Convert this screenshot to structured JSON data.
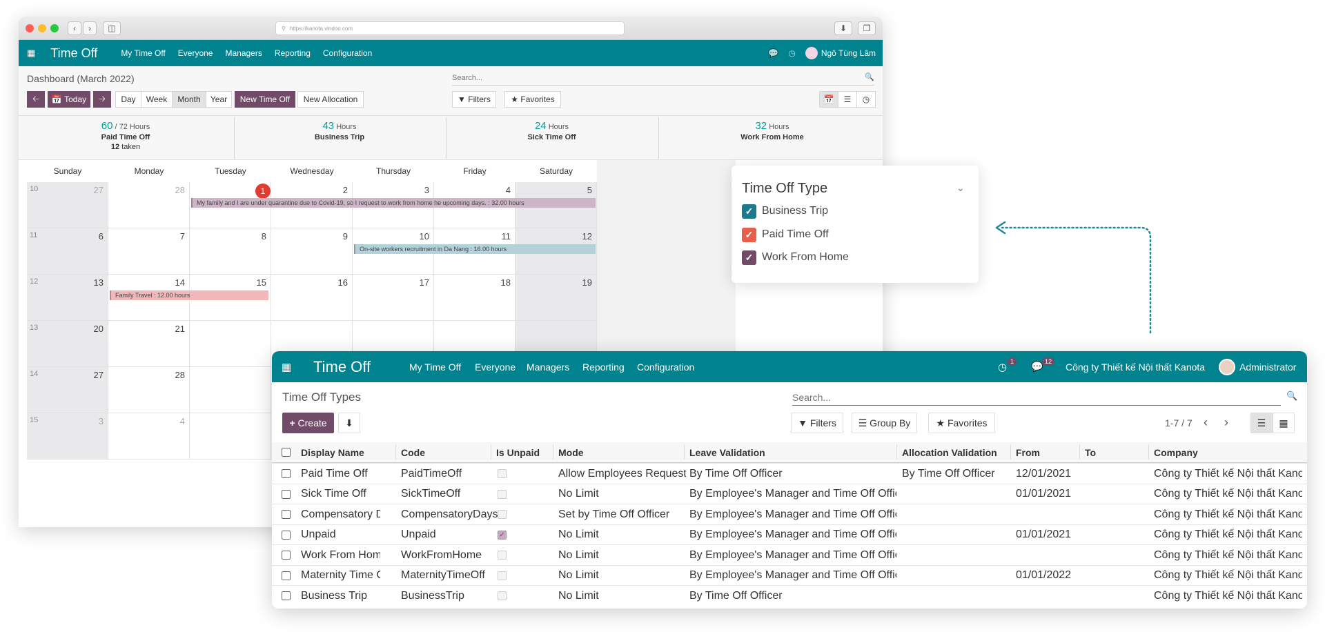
{
  "back_window": {
    "url": "https://kanota.vindoo.com",
    "nav": {
      "brand": "Time Off",
      "menus": [
        "My Time Off",
        "Everyone",
        "Managers",
        "Reporting",
        "Configuration"
      ],
      "user": "Ngô Tùng Lâm"
    },
    "control": {
      "breadcrumb": "Dashboard (March 2022)",
      "today_label": "Today",
      "views": [
        "Day",
        "Week",
        "Month",
        "Year"
      ],
      "active_view": "Month",
      "new_time_off": "New Time Off",
      "new_allocation": "New Allocation",
      "search_placeholder": "Search...",
      "filters": "Filters",
      "favorites": "Favorites"
    },
    "stats": [
      {
        "num": "60",
        "unit": " / 72 Hours",
        "label": "Paid Time Off",
        "extra_num": "12",
        "extra": " taken"
      },
      {
        "num": "43",
        "unit": " Hours",
        "label": "Business Trip"
      },
      {
        "num": "24",
        "unit": " Hours",
        "label": "Sick Time Off"
      },
      {
        "num": "32",
        "unit": " Hours",
        "label": "Work From Home"
      }
    ],
    "calendar": {
      "days": [
        "Sunday",
        "Monday",
        "Tuesday",
        "Wednesday",
        "Thursday",
        "Friday",
        "Saturday"
      ],
      "weeks": [
        {
          "wk": "10",
          "dates": [
            "27",
            "28",
            "1",
            "2",
            "3",
            "4",
            "5"
          ],
          "muted": [
            true,
            true,
            false,
            false,
            false,
            false,
            false
          ]
        },
        {
          "wk": "11",
          "dates": [
            "6",
            "7",
            "8",
            "9",
            "10",
            "11",
            "12"
          ],
          "muted": [
            false,
            false,
            false,
            false,
            false,
            false,
            false
          ]
        },
        {
          "wk": "12",
          "dates": [
            "13",
            "14",
            "15",
            "16",
            "17",
            "18",
            "19"
          ],
          "muted": [
            false,
            false,
            false,
            false,
            false,
            false,
            false
          ]
        },
        {
          "wk": "13",
          "dates": [
            "20",
            "21",
            "",
            "",
            "",
            "",
            ""
          ],
          "muted": [
            false,
            false,
            false,
            false,
            false,
            false,
            false
          ]
        },
        {
          "wk": "14",
          "dates": [
            "27",
            "28",
            "",
            "",
            "",
            "",
            ""
          ],
          "muted": [
            false,
            false,
            false,
            false,
            false,
            false,
            false
          ]
        },
        {
          "wk": "15",
          "dates": [
            "3",
            "4",
            "",
            "",
            "",
            "",
            ""
          ],
          "muted": [
            true,
            true,
            false,
            false,
            false,
            false,
            false
          ]
        }
      ],
      "events": [
        {
          "text": "My family and I are under quarantine due to Covid-19, so I request to work from home he upcoming days. : 32.00 hours",
          "color": "#cdb4c6"
        },
        {
          "text": "On-site workers recruitment in Da Nang : 16.00 hours",
          "color": "#b3d1d8"
        },
        {
          "text": "Family Travel : 12.00 hours",
          "color": "#f0b8b8"
        }
      ]
    }
  },
  "filter_panel": {
    "title": "Time Off Type",
    "items": [
      {
        "label": "Business Trip",
        "color": "#1d7a8c"
      },
      {
        "label": "Paid Time Off",
        "color": "#e8604c"
      },
      {
        "label": "Work From Home",
        "color": "#714b67"
      }
    ]
  },
  "front_window": {
    "nav": {
      "brand": "Time Off",
      "menus": [
        "My Time Off",
        "Everyone",
        "Managers",
        "Reporting",
        "Configuration"
      ],
      "activity_count": "1",
      "message_count": "12",
      "company": "Công ty Thiết kế Nội thất Kanota",
      "user": "Administrator"
    },
    "control": {
      "breadcrumb": "Time Off Types",
      "create": "Create",
      "search_placeholder": "Search...",
      "filters": "Filters",
      "group_by": "Group By",
      "favorites": "Favorites",
      "pager": "1-7 / 7"
    },
    "table": {
      "headers": [
        "Display Name",
        "Code",
        "Is Unpaid",
        "Mode",
        "Leave Validation",
        "Allocation Validation",
        "From",
        "To",
        "Company"
      ],
      "rows": [
        {
          "name": "Paid Time Off",
          "code": "PaidTimeOff",
          "unpaid": false,
          "mode": "Allow Employees Requests",
          "leave": "By Time Off Officer",
          "alloc": "By Time Off Officer",
          "from": "12/01/2021",
          "to": "",
          "company": "Công ty Thiết kế Nội thất Kanota"
        },
        {
          "name": "Sick Time Off",
          "code": "SickTimeOff",
          "unpaid": false,
          "mode": "No Limit",
          "leave": "By Employee's Manager and Time Off Officer",
          "alloc": "",
          "from": "01/01/2021",
          "to": "",
          "company": "Công ty Thiết kế Nội thất Kanota"
        },
        {
          "name": "Compensatory Days",
          "code": "CompensatoryDays",
          "unpaid": false,
          "mode": "Set by Time Off Officer",
          "leave": "By Employee's Manager and Time Off Officer",
          "alloc": "",
          "from": "",
          "to": "",
          "company": "Công ty Thiết kế Nội thất Kanota"
        },
        {
          "name": "Unpaid",
          "code": "Unpaid",
          "unpaid": true,
          "mode": "No Limit",
          "leave": "By Employee's Manager and Time Off Officer",
          "alloc": "",
          "from": "01/01/2021",
          "to": "",
          "company": "Công ty Thiết kế Nội thất Kanota"
        },
        {
          "name": "Work From Home",
          "code": "WorkFromHome",
          "unpaid": false,
          "mode": "No Limit",
          "leave": "By Employee's Manager and Time Off Officer",
          "alloc": "",
          "from": "",
          "to": "",
          "company": "Công ty Thiết kế Nội thất Kanota"
        },
        {
          "name": "Maternity Time Off",
          "code": "MaternityTimeOff",
          "unpaid": false,
          "mode": "No Limit",
          "leave": "By Employee's Manager and Time Off Officer",
          "alloc": "",
          "from": "01/01/2022",
          "to": "",
          "company": "Công ty Thiết kế Nội thất Kanota"
        },
        {
          "name": "Business Trip",
          "code": "BusinessTrip",
          "unpaid": false,
          "mode": "No Limit",
          "leave": "By Time Off Officer",
          "alloc": "",
          "from": "",
          "to": "",
          "company": "Công ty Thiết kế Nội thất Kanota"
        }
      ]
    }
  },
  "colors": {
    "teal": "#00838f",
    "purple": "#714b67",
    "today_red": "#e03c31",
    "stat_teal": "#00a09d"
  }
}
